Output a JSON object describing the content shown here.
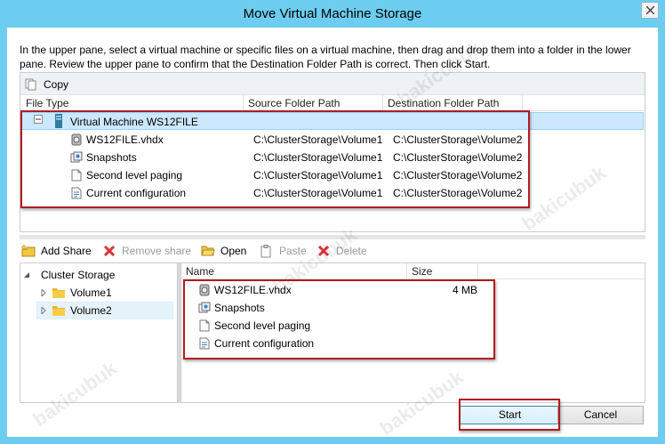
{
  "window": {
    "title": "Move Virtual Machine Storage"
  },
  "instructions": "In the upper pane, select a virtual machine or specific files on a virtual machine, then drag and drop them into a folder in the lower pane.  Review the upper pane to confirm that the Destination Folder Path is correct. Then click Start.",
  "upper_toolbar": {
    "copy_label": "Copy"
  },
  "upper_columns": {
    "file_type": "File Type",
    "source": "Source Folder Path",
    "destination": "Destination Folder Path"
  },
  "upper_rows": {
    "vm": {
      "label": "Virtual Machine WS12FILE"
    },
    "items": [
      {
        "name": "WS12FILE.vhdx",
        "icon": "disk-icon",
        "source": "C:\\ClusterStorage\\Volume1",
        "destination": "C:\\ClusterStorage\\Volume2"
      },
      {
        "name": "Snapshots",
        "icon": "snapshot-icon",
        "source": "C:\\ClusterStorage\\Volume1",
        "destination": "C:\\ClusterStorage\\Volume2"
      },
      {
        "name": "Second level paging",
        "icon": "file-icon",
        "source": "C:\\ClusterStorage\\Volume1",
        "destination": "C:\\ClusterStorage\\Volume2"
      },
      {
        "name": "Current configuration",
        "icon": "config-icon",
        "source": "C:\\ClusterStorage\\Volume1",
        "destination": "C:\\ClusterStorage\\Volume2"
      }
    ]
  },
  "lower_toolbar": {
    "add_share": "Add Share",
    "remove_share": "Remove share",
    "open": "Open",
    "paste": "Paste",
    "delete": "Delete"
  },
  "tree": {
    "root": "Cluster Storage",
    "items": [
      {
        "label": "Volume1"
      },
      {
        "label": "Volume2"
      }
    ]
  },
  "list_columns": {
    "name": "Name",
    "size": "Size"
  },
  "list_items": [
    {
      "name": "WS12FILE.vhdx",
      "size": "4 MB"
    },
    {
      "name": "Snapshots",
      "size": ""
    },
    {
      "name": "Second level paging",
      "size": ""
    },
    {
      "name": "Current configuration",
      "size": ""
    }
  ],
  "buttons": {
    "start": "Start",
    "cancel": "Cancel"
  },
  "watermark": "bakicubuk",
  "colors": {
    "highlight_box": "#b01c23",
    "titlebar": "#6ccdf0"
  }
}
